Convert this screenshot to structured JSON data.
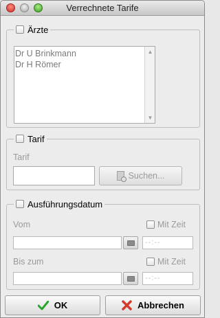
{
  "window": {
    "title": "Verrechnete Tarife"
  },
  "aerzte": {
    "label": "Ärzte",
    "items": [
      "Dr U Brinkmann",
      "Dr H Römer"
    ]
  },
  "tarif": {
    "label": "Tarif",
    "field_label": "Tarif",
    "field_value": "",
    "search_button": "Suchen..."
  },
  "ausfuehrung": {
    "label": "Ausführungsdatum",
    "vom_label": "Vom",
    "bis_label": "Bis zum",
    "mit_zeit_label": "Mit Zeit",
    "time_placeholder": "--:--"
  },
  "buttons": {
    "ok": "OK",
    "cancel": "Abbrechen"
  },
  "colors": {
    "ok_check": "#2aa52a",
    "cancel_x": "#d23a2a"
  },
  "icons": [
    "close-button",
    "minimize-button",
    "zoom-button",
    "checkbox",
    "scroll-up-arrow",
    "scroll-down-arrow",
    "search-document-icon",
    "calendar-icon",
    "checkmark-icon",
    "x-icon"
  ]
}
